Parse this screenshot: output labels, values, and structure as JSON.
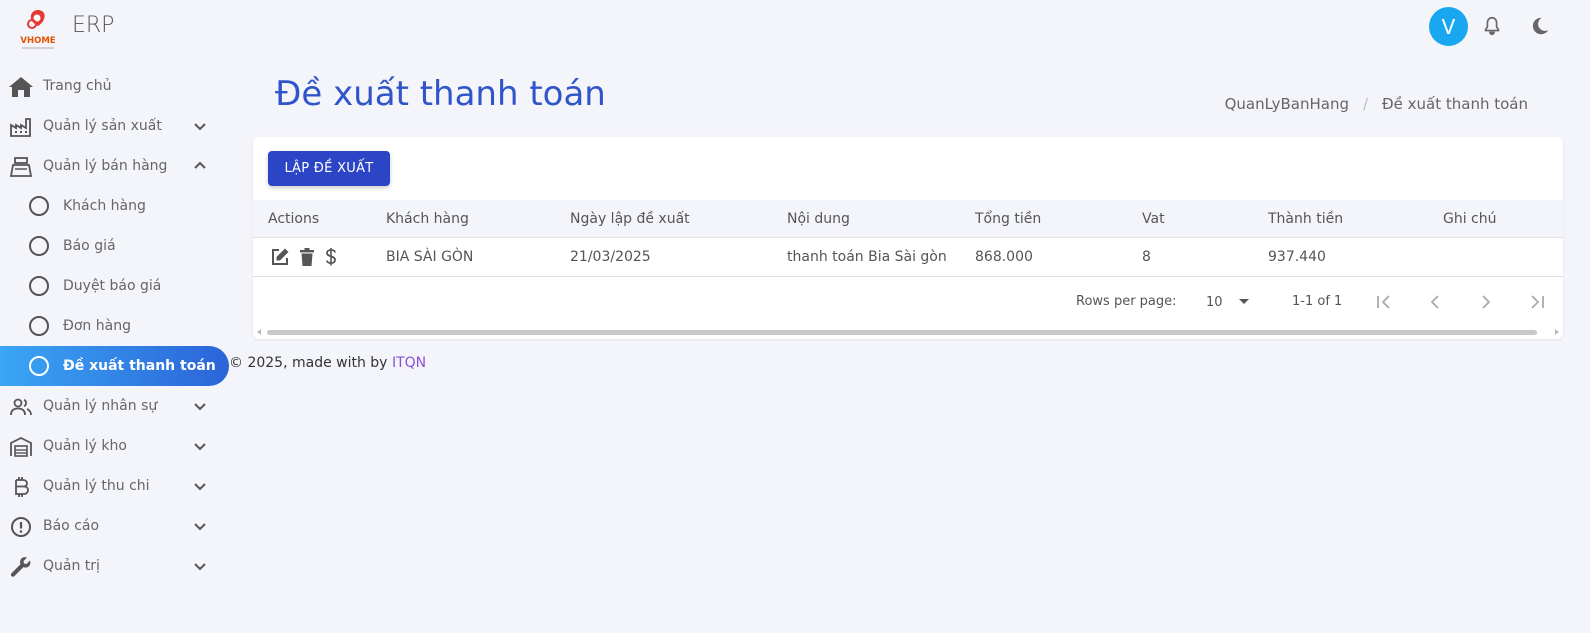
{
  "header": {
    "logo_text": "VHOME",
    "app_name": "ERP",
    "avatar_letter": "V",
    "icons": [
      "bell-icon",
      "moon-icon"
    ]
  },
  "sidebar": {
    "items": [
      {
        "label": "Trang chủ",
        "icon": "home-icon"
      },
      {
        "label": "Quản lý sản xuất",
        "icon": "factory-icon"
      },
      {
        "label": "Quản lý bán hàng",
        "icon": "cash-register-icon"
      },
      {
        "label": "Khách hàng"
      },
      {
        "label": "Báo giá"
      },
      {
        "label": "Duyệt báo giá"
      },
      {
        "label": "Đơn hàng"
      },
      {
        "label": "Đề xuất thanh toán"
      },
      {
        "label": "Quản lý nhân sự",
        "icon": "people-icon"
      },
      {
        "label": "Quản lý kho",
        "icon": "warehouse-icon"
      },
      {
        "label": "Quản lý thu chi",
        "icon": "bitcoin-icon"
      },
      {
        "label": "Báo cáo",
        "icon": "alert-circle-icon"
      },
      {
        "label": "Quản trị",
        "icon": "wrench-icon"
      }
    ]
  },
  "page": {
    "title": "Đề xuất thanh toán",
    "breadcrumb": [
      "QuanLyBanHang",
      "/",
      "Đề xuất thanh toán"
    ],
    "create_button": "LẬP ĐỀ XUẤT"
  },
  "table": {
    "columns": [
      "Actions",
      "Khách hàng",
      "Ngày lập đề xuất",
      "Nội dung",
      "Tổng tiền",
      "Vat",
      "Thành tiền",
      "Ghi chú"
    ],
    "rows": [
      {
        "customer": "BIA SÀI GÒN",
        "date": "21/03/2025",
        "content": "thanh toán Bia Sài gòn",
        "total": "868.000",
        "vat": "8",
        "amount": "937.440",
        "note": ""
      }
    ],
    "pagination": {
      "rows_per_page_label": "Rows per page:",
      "rows_per_page": "10",
      "range": "1-1 of 1"
    }
  },
  "footer": {
    "text": "© 2025, made with by",
    "link": "ITQN"
  },
  "colors": {
    "primary": "#2b45c6",
    "title": "#2f55c8",
    "active_gradient_start": "#3aa6f5",
    "active_gradient_end": "#2b64d8",
    "avatar": "#19a8f0",
    "footer_link": "#8a4fd8"
  }
}
